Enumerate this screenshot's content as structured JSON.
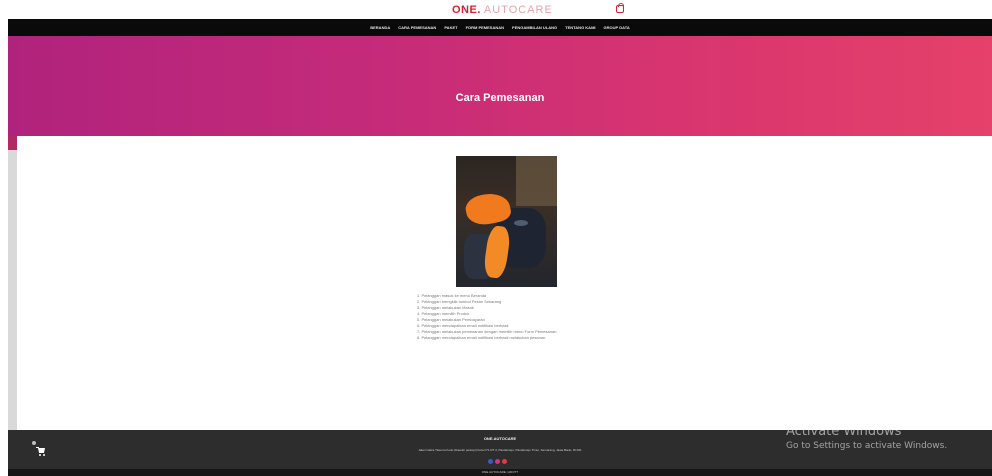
{
  "header": {
    "brand_bold": "ONE.",
    "brand_light": "AUTOCARE",
    "cart_icon": "shopping-bag-icon"
  },
  "nav": {
    "items": [
      "BERANDA",
      "CARA PEMESANAN",
      "PAKET",
      "FORM PEMESANAN",
      "PENGAMBILAN ULANG",
      "TENTANG KAMI",
      "GROUP DATA"
    ]
  },
  "hero": {
    "title": "Cara Pemesanan"
  },
  "main": {
    "image_subject": "orange microfiber cloth on car interior",
    "steps": [
      "1. Pelanggan masuk ke menu Beranda",
      "2. Pelanggan mengklik tombol Pesan Sekarang",
      "3. Pelanggan melakukan Masuk",
      "4. Pelanggan memilih Produk",
      "5. Pelanggan melakukan Pembayaran",
      "6. Pelanggan mendapatkan email notifikasi berhasil",
      "7. Pelanggan melakukan pemesanan dengan memilih menu Form Pemesanan",
      "8. Pelanggan mendapatkan email notifikasi berhasil melakukan pesanan"
    ]
  },
  "footer": {
    "title": "ONE.AUTOCARE",
    "address": "Jalan Cakra Tiwuma Kodo (Daerah perkopi) Kota N°1 RT 3, Pandanrejo, Pandanrejo Timur, Semarang, Jawa Barat, ID 001",
    "social_icons": [
      "facebook-icon",
      "instagram-icon",
      "youtube-icon"
    ],
    "cart_icon": "cart-icon",
    "copyright": "ONE.AUTOCARE | ADOTT"
  },
  "os_overlay": {
    "title": "Activate Windows",
    "subtitle": "Go to Settings to activate Windows."
  },
  "colors": {
    "brand_red": "#d62230",
    "nav_bg": "#0a0a0a",
    "hero_start": "#b0237c",
    "hero_end": "#e5416a",
    "footer_bg": "#2d2d2d"
  }
}
